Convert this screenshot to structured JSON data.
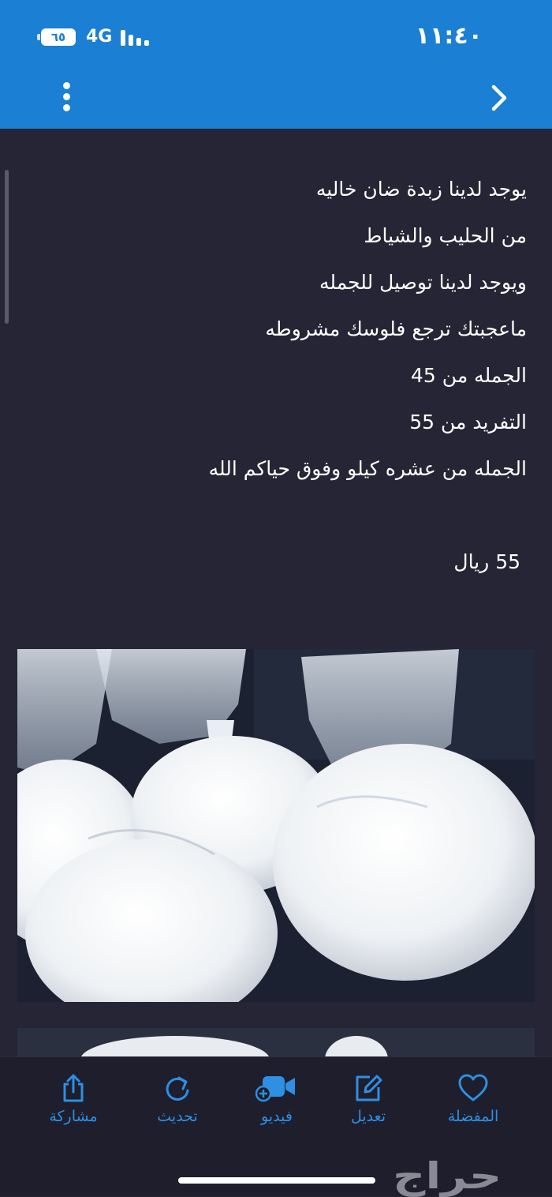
{
  "status_bar": {
    "time": "١١:٤٠",
    "battery": "٦٥",
    "network": "4G"
  },
  "description_lines": [
    "يوجد لدينا زبدة ضان خاليه",
    "من الحليب والشياط",
    "ويوجد لدينا توصيل للجمله",
    "ماعجبتك ترجع فلوسك مشروطه",
    "الجمله من 45",
    "التفريد من 55",
    "الجمله من عشره كيلو وفوق حياكم الله"
  ],
  "price": "55 ريال",
  "tabs": [
    {
      "label": "المفضلة",
      "icon": "heart-icon"
    },
    {
      "label": "تعديل",
      "icon": "edit-icon"
    },
    {
      "label": "فيديو",
      "icon": "video-add-icon"
    },
    {
      "label": "تحديث",
      "icon": "refresh-icon"
    },
    {
      "label": "مشاركة",
      "icon": "share-icon"
    }
  ],
  "watermark": "حراج",
  "colors": {
    "header": "#1b7fd3",
    "background": "#252535",
    "tab_accent": "#2e8fe3"
  }
}
